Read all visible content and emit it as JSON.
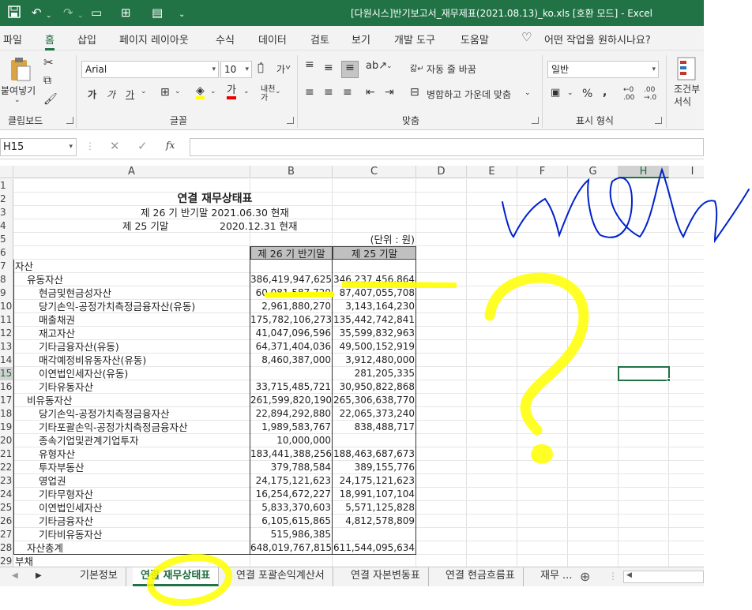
{
  "app": {
    "title": "[다원시스]반기보고서_재무제표(2021.08.13)_ko.xls  [호환 모드]  -  Excel"
  },
  "menu": [
    "파일",
    "홈",
    "삽입",
    "페이지 레이아웃",
    "수식",
    "데이터",
    "검토",
    "보기",
    "개발 도구",
    "도움말",
    "어떤 작업을 원하시나요?"
  ],
  "ribbon": {
    "paste": "붙여넣기",
    "clipboard": "클립보드",
    "font_name": "Arial",
    "font_size": "10",
    "font_group": "글꼴",
    "wrap_text": "자동 줄 바꿈",
    "merge_center": "병합하고 가운데 맞춤",
    "align_group": "맞춤",
    "number_format": "일반",
    "number_group": "표시 형식",
    "conditional": "조건부",
    "conditional2": "서식"
  },
  "formula_bar": {
    "name_box": "H15",
    "formula": ""
  },
  "columns": [
    "A",
    "B",
    "C",
    "D",
    "E",
    "F",
    "G",
    "H",
    "I"
  ],
  "selected_column": "H",
  "selected_row": "15",
  "sheet": {
    "title": "연결 재무상태표",
    "period1": "제 26 기 반기말  2021.06.30 현재",
    "period2_label": "제 25 기말",
    "period2_date": "2020.12.31 현재",
    "unit": "(단위 : 원)",
    "col_b_header": "제 26 기 반기말",
    "col_c_header": "제 25 기말",
    "rows": [
      {
        "n": "1",
        "a": "",
        "b": "",
        "c": ""
      },
      {
        "n": "2",
        "a": "",
        "b": "",
        "c": ""
      },
      {
        "n": "3",
        "a": "",
        "b": "",
        "c": ""
      },
      {
        "n": "4",
        "a": "",
        "b": "",
        "c": ""
      },
      {
        "n": "5",
        "a": "",
        "b": "",
        "c": ""
      },
      {
        "n": "6",
        "a": "",
        "b": "",
        "c": ""
      },
      {
        "n": "7",
        "a": "자산",
        "b": "",
        "c": ""
      },
      {
        "n": "8",
        "a": "유동자산",
        "b": "386,419,947,625",
        "c": "346,237,456,864"
      },
      {
        "n": "9",
        "a": "현금및현금성자산",
        "b": "60,081,587,729",
        "c": "87,407,055,708"
      },
      {
        "n": "10",
        "a": "당기손익-공정가치측정금융자산(유동)",
        "b": "2,961,880,270",
        "c": "3,143,164,230"
      },
      {
        "n": "11",
        "a": "매출채권",
        "b": "175,782,106,273",
        "c": "135,442,742,841"
      },
      {
        "n": "12",
        "a": "재고자산",
        "b": "41,047,096,596",
        "c": "35,599,832,963"
      },
      {
        "n": "13",
        "a": "기타금융자산(유동)",
        "b": "64,371,404,036",
        "c": "49,500,152,919"
      },
      {
        "n": "14",
        "a": "매각예정비유동자산(유동)",
        "b": "8,460,387,000",
        "c": "3,912,480,000"
      },
      {
        "n": "15",
        "a": "이연법인세자산(유동)",
        "b": "",
        "c": "281,205,335"
      },
      {
        "n": "16",
        "a": "기타유동자산",
        "b": "33,715,485,721",
        "c": "30,950,822,868"
      },
      {
        "n": "17",
        "a": "비유동자산",
        "b": "261,599,820,190",
        "c": "265,306,638,770"
      },
      {
        "n": "18",
        "a": "당기손익-공정가치측정금융자산",
        "b": "22,894,292,880",
        "c": "22,065,373,240"
      },
      {
        "n": "19",
        "a": "기타포괄손익-공정가치측정금융자산",
        "b": "1,989,583,767",
        "c": "838,488,717"
      },
      {
        "n": "20",
        "a": "종속기업및관계기업투자",
        "b": "10,000,000",
        "c": ""
      },
      {
        "n": "21",
        "a": "유형자산",
        "b": "183,441,388,256",
        "c": "188,463,687,673"
      },
      {
        "n": "22",
        "a": "투자부동산",
        "b": "379,788,584",
        "c": "389,155,776"
      },
      {
        "n": "23",
        "a": "영업권",
        "b": "24,175,121,623",
        "c": "24,175,121,623"
      },
      {
        "n": "24",
        "a": "기타무형자산",
        "b": "16,254,672,227",
        "c": "18,991,107,104"
      },
      {
        "n": "25",
        "a": "이연법인세자산",
        "b": "5,833,370,603",
        "c": "5,571,125,828"
      },
      {
        "n": "26",
        "a": "기타금융자산",
        "b": "6,105,615,865",
        "c": "4,812,578,809"
      },
      {
        "n": "27",
        "a": "기타비유동자산",
        "b": "515,986,385",
        "c": ""
      },
      {
        "n": "28",
        "a": "자산총계",
        "b": "648,019,767,815",
        "c": "611,544,095,634"
      },
      {
        "n": "29",
        "a": "부채",
        "b": "",
        "c": ""
      }
    ]
  },
  "tabs": [
    "기본정보",
    "연결 재무상태표",
    "연결 포괄손익계산서",
    "연결 자본변동표",
    "연결 현금흐름표",
    "재무 ..."
  ],
  "active_tab": "연결 재무상태표",
  "colors": {
    "excel_green": "#217346",
    "highlight": "#ffff00",
    "annotation_blue": "#0022cc"
  }
}
